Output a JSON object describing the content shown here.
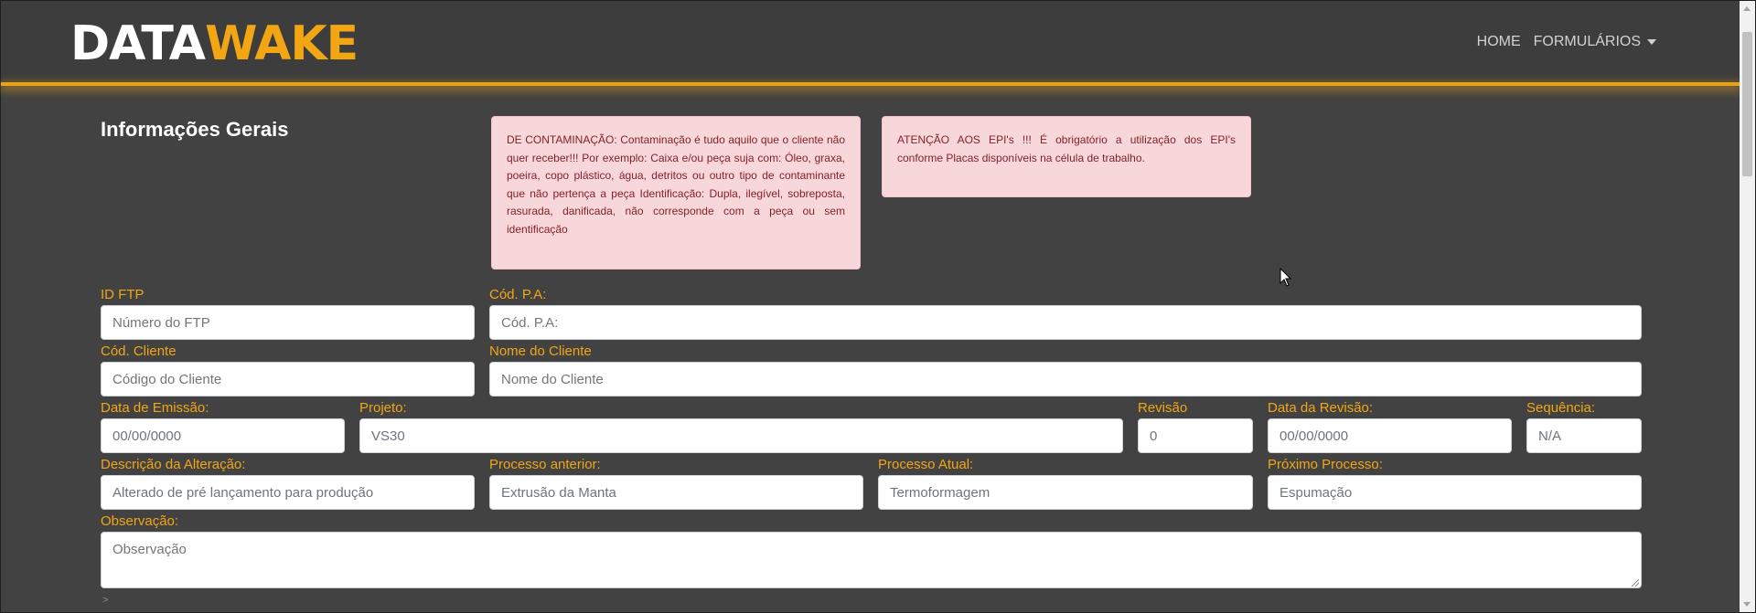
{
  "brand": {
    "part1": "DATA",
    "part2": "WAKE"
  },
  "nav": {
    "home": "HOME",
    "forms": "FORMULÁRIOS"
  },
  "section_title": "Informações Gerais",
  "alerts": {
    "contamination": "DE CONTAMINAÇÃO: Contaminação é tudo aquilo que o cliente não quer receber!!! Por exemplo: Caixa e/ou peça suja com: Óleo, graxa, poeira, copo plástico, água, detritos ou outro tipo de contaminante que não pertença a peça Identificação: Dupla, ilegível, sobreposta, rasurada, danificada, não corresponde com a peça ou sem identificação",
    "epi": "ATENÇÃO AOS EPI's !!! É obrigatório a utilização dos EPI's conforme Placas disponíveis na célula de trabalho."
  },
  "form": {
    "id_ftp": {
      "label": "ID FTP",
      "placeholder": "Número do FTP"
    },
    "cod_pa": {
      "label": "Cód. P.A:",
      "placeholder": "Cód. P.A:"
    },
    "cod_cliente": {
      "label": "Cód. Cliente",
      "placeholder": "Código do Cliente"
    },
    "nome_cliente": {
      "label": "Nome do Cliente",
      "placeholder": "Nome do Cliente"
    },
    "data_emissao": {
      "label": "Data de Emissão:",
      "value": "00/00/0000"
    },
    "projeto": {
      "label": "Projeto:",
      "value": "VS30"
    },
    "revisao": {
      "label": "Revisão",
      "value": "0"
    },
    "data_revisao": {
      "label": "Data da Revisão:",
      "value": "00/00/0000"
    },
    "sequencia": {
      "label": "Sequência:",
      "value": "N/A"
    },
    "descricao": {
      "label": "Descrição da Alteração:",
      "value": "Alterado de pré lançamento para produção"
    },
    "processo_anterior": {
      "label": "Processo anterior:",
      "value": "Extrusão da Manta"
    },
    "processo_atual": {
      "label": "Processo Atual:",
      "value": "Termoformagem"
    },
    "proximo_processo": {
      "label": "Próximo Processo:",
      "value": "Espumação"
    },
    "observacao": {
      "label": "Observação:",
      "placeholder": "Observação"
    }
  },
  "bottom_mark": ">",
  "colors": {
    "accent": "#f3a614",
    "background": "#424242",
    "alert_bg": "#f8d7da"
  }
}
